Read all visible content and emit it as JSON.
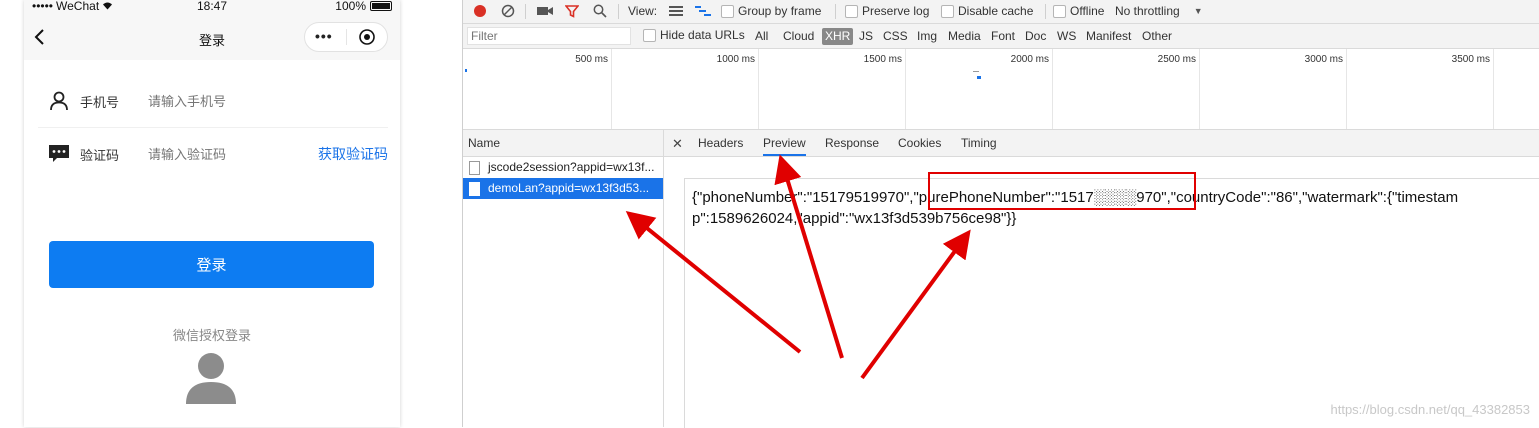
{
  "phone": {
    "status": {
      "carrier": "WeChat",
      "time": "18:47",
      "battery": "100%"
    },
    "nav": {
      "title": "登录",
      "menu_dots": "•••"
    },
    "form": {
      "phone_label": "手机号",
      "phone_placeholder": "请输入手机号",
      "code_label": "验证码",
      "code_placeholder": "请输入验证码",
      "get_code": "获取验证码"
    },
    "login_button": "登录",
    "wechat_login": "微信授权登录",
    "colors": {
      "primary": "#0d7cf2",
      "link": "#1a73e8"
    }
  },
  "devtools": {
    "toolbar": {
      "view_label": "View:",
      "group_by_frame": "Group by frame",
      "preserve_log": "Preserve log",
      "disable_cache": "Disable cache",
      "offline": "Offline",
      "throttling": "No throttling"
    },
    "filter": {
      "placeholder": "Filter",
      "hide_data_urls": "Hide data URLs",
      "types": [
        "All",
        "Cloud",
        "XHR",
        "JS",
        "CSS",
        "Img",
        "Media",
        "Font",
        "Doc",
        "WS",
        "Manifest",
        "Other"
      ],
      "active_type": "XHR"
    },
    "overview_ticks": [
      "500 ms",
      "1000 ms",
      "1500 ms",
      "2000 ms",
      "2500 ms",
      "3000 ms",
      "3500 ms"
    ],
    "requests": {
      "header": "Name",
      "items": [
        {
          "name": "jscode2session?appid=wx13f...",
          "selected": false
        },
        {
          "name": "demoLan?appid=wx13f3d53...",
          "selected": true
        }
      ]
    },
    "detail_tabs": [
      "Headers",
      "Preview",
      "Response",
      "Cookies",
      "Timing"
    ],
    "active_tab": "Preview",
    "preview_text": "{\"phoneNumber\":\"15179519970\",\"purePhoneNumber\":\"1517░░░░970\",\"countryCode\":\"86\",\"watermark\":{\"timestamp\":1589626024,\"appid\":\"wx13f3d539b756ce98\"}}",
    "watermark": "https://blog.csdn.net/qq_43382853"
  },
  "annotation_color": "#e00000"
}
